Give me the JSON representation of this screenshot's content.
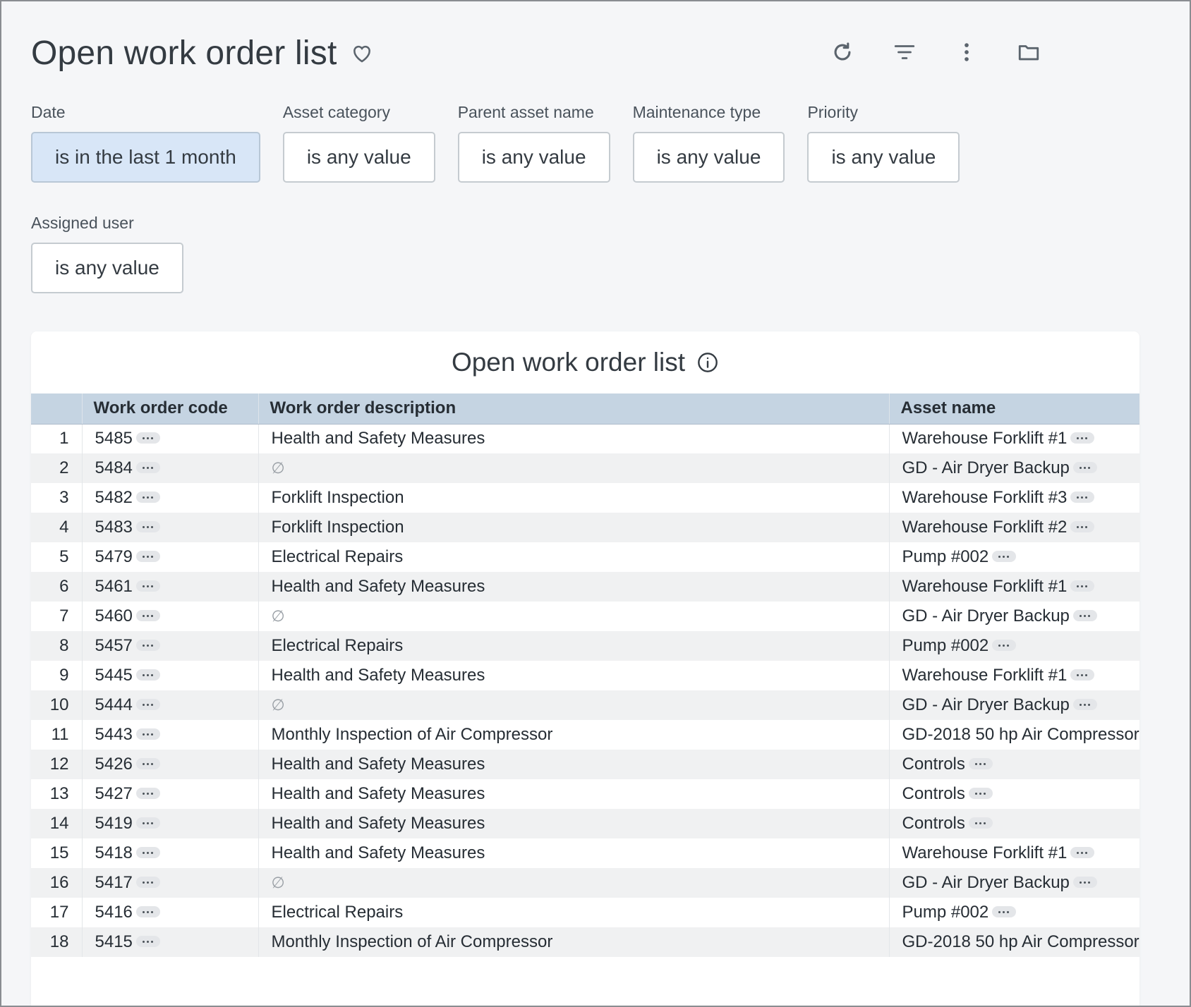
{
  "page": {
    "title": "Open work order list"
  },
  "filters": [
    {
      "label": "Date",
      "value": "is in the last 1 month",
      "active": true
    },
    {
      "label": "Asset category",
      "value": "is any value"
    },
    {
      "label": "Parent asset name",
      "value": "is any value"
    },
    {
      "label": "Maintenance type",
      "value": "is any value"
    },
    {
      "label": "Priority",
      "value": "is any value"
    },
    {
      "label": "Assigned user",
      "value": "is any value"
    }
  ],
  "card": {
    "title": "Open work order list"
  },
  "table": {
    "columns": [
      "",
      "Work order code",
      "Work order description",
      "Asset name"
    ],
    "null_symbol": "∅",
    "rows": [
      {
        "num": "1",
        "code": "5485",
        "description": "Health and Safety Measures",
        "asset": "Warehouse Forklift #1"
      },
      {
        "num": "2",
        "code": "5484",
        "description": "",
        "asset": "GD - Air Dryer Backup"
      },
      {
        "num": "3",
        "code": "5482",
        "description": "Forklift Inspection",
        "asset": "Warehouse Forklift #3"
      },
      {
        "num": "4",
        "code": "5483",
        "description": "Forklift Inspection",
        "asset": "Warehouse Forklift #2"
      },
      {
        "num": "5",
        "code": "5479",
        "description": "Electrical Repairs",
        "asset": "Pump #002"
      },
      {
        "num": "6",
        "code": "5461",
        "description": "Health and Safety Measures",
        "asset": "Warehouse Forklift #1"
      },
      {
        "num": "7",
        "code": "5460",
        "description": "",
        "asset": "GD - Air Dryer Backup"
      },
      {
        "num": "8",
        "code": "5457",
        "description": "Electrical Repairs",
        "asset": "Pump #002"
      },
      {
        "num": "9",
        "code": "5445",
        "description": "Health and Safety Measures",
        "asset": "Warehouse Forklift #1"
      },
      {
        "num": "10",
        "code": "5444",
        "description": "",
        "asset": "GD - Air Dryer Backup"
      },
      {
        "num": "11",
        "code": "5443",
        "description": "Monthly Inspection of Air Compressor",
        "asset": "GD-2018 50 hp Air Compressor"
      },
      {
        "num": "12",
        "code": "5426",
        "description": "Health and Safety Measures",
        "asset": "Controls"
      },
      {
        "num": "13",
        "code": "5427",
        "description": "Health and Safety Measures",
        "asset": "Controls"
      },
      {
        "num": "14",
        "code": "5419",
        "description": "Health and Safety Measures",
        "asset": "Controls"
      },
      {
        "num": "15",
        "code": "5418",
        "description": "Health and Safety Measures",
        "asset": "Warehouse Forklift #1"
      },
      {
        "num": "16",
        "code": "5417",
        "description": "",
        "asset": "GD - Air Dryer Backup"
      },
      {
        "num": "17",
        "code": "5416",
        "description": "Electrical Repairs",
        "asset": "Pump #002"
      },
      {
        "num": "18",
        "code": "5415",
        "description": "Monthly Inspection of Air Compressor",
        "asset": "GD-2018 50 hp Air Compressor"
      }
    ]
  },
  "colors": {
    "header_bg": "#c5d4e2",
    "active_filter_bg": "#d8e6f7",
    "page_bg": "#f5f6f8"
  },
  "icons": [
    "heart-icon",
    "refresh-icon",
    "filter-icon",
    "more-vertical-icon",
    "folder-icon",
    "info-icon",
    "more-horizontal-icon"
  ]
}
